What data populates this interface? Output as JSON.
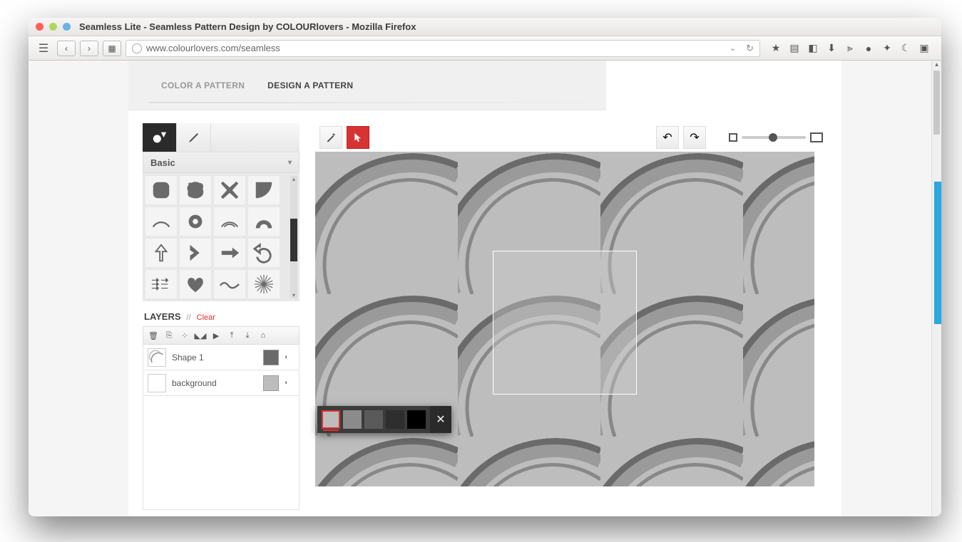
{
  "window_title": "Seamless Lite - Seamless Pattern Design by COLOURlovers - Mozilla Firefox",
  "url": "www.colourlovers.com/seamless",
  "tabs": {
    "color": "COLOR A PATTERN",
    "design": "DESIGN A PATTERN"
  },
  "shape_category": "Basic",
  "layers": {
    "header": "LAYERS",
    "clear": "Clear"
  },
  "layer1": {
    "name": "Shape 1",
    "swatch": "#6a6a6a"
  },
  "layer2": {
    "name": "background",
    "swatch": "#bdbdbd"
  },
  "picker": {
    "swatches": [
      "#bdbdbd",
      "#8b8b8b",
      "#5a5a5a",
      "#2e2e2e",
      "#000000"
    ]
  }
}
